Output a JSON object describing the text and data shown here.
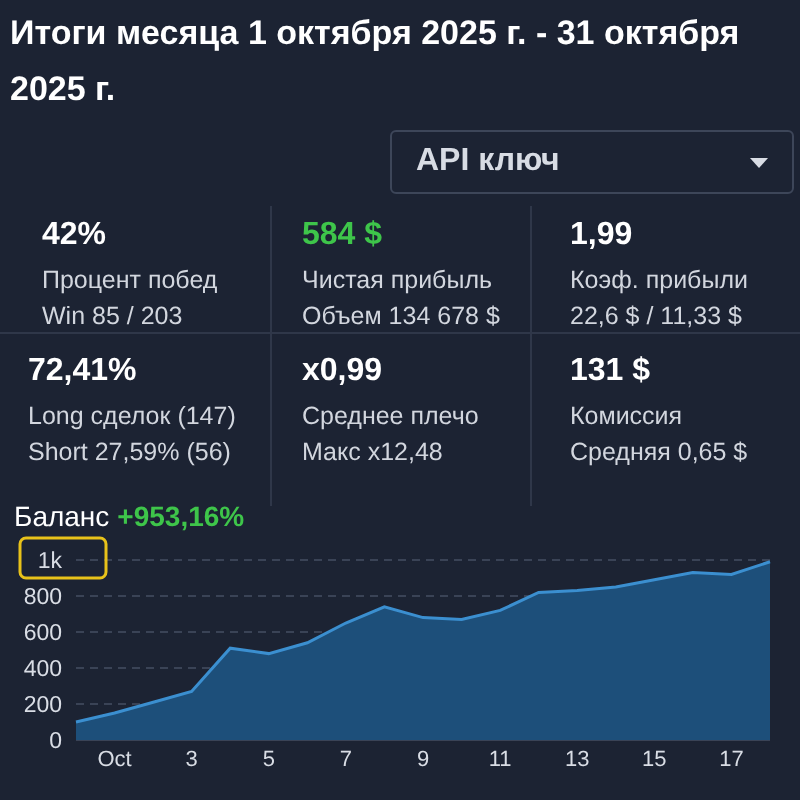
{
  "title": "Итоги месяца 1 октября 2025 г. - 31 октября 2025 г.",
  "api_select": {
    "value": "API ключ"
  },
  "stats": [
    {
      "value": "42%",
      "positive": false,
      "label": "Процент побед",
      "detail": "Win 85 / 203"
    },
    {
      "value": "584 $",
      "positive": true,
      "label": "Чистая прибыль",
      "detail": "Объем 134 678 $"
    },
    {
      "value": "1,99",
      "positive": false,
      "label": "Коэф. прибыли",
      "detail": "22,6 $ / 11,33 $"
    },
    {
      "value": "72,41%",
      "positive": false,
      "label": "Long сделок (147)",
      "detail": "Short 27,59% (56)"
    },
    {
      "value": "x0,99",
      "positive": false,
      "label": "Среднее плечо",
      "detail": "Макс x12,48"
    },
    {
      "value": "131 $",
      "positive": false,
      "label": "Комиссия",
      "detail": "Средняя 0,65 $"
    }
  ],
  "balance": {
    "label": "Баланс",
    "change": "+953,16%",
    "chart_data": {
      "type": "area",
      "x": [
        0,
        1,
        2,
        3,
        4,
        5,
        6,
        7,
        8,
        9,
        10,
        11,
        12,
        13,
        14,
        15,
        16,
        17,
        18
      ],
      "xlim": [
        0,
        18
      ],
      "grid": true,
      "series": [
        {
          "color": "#3b8fd0",
          "values": [
            100,
            150,
            210,
            270,
            510,
            480,
            540,
            650,
            740,
            680,
            670,
            720,
            820,
            830,
            850,
            890,
            930,
            920,
            990
          ]
        }
      ],
      "ylim": [
        0,
        1000
      ],
      "yticks": [
        0,
        200,
        400,
        600,
        800,
        {
          "value": 1000,
          "label": "1k"
        }
      ],
      "xticks": [
        {
          "value": 1,
          "label": "Oct"
        },
        3,
        5,
        7,
        9,
        11,
        13,
        15,
        17
      ]
    }
  }
}
